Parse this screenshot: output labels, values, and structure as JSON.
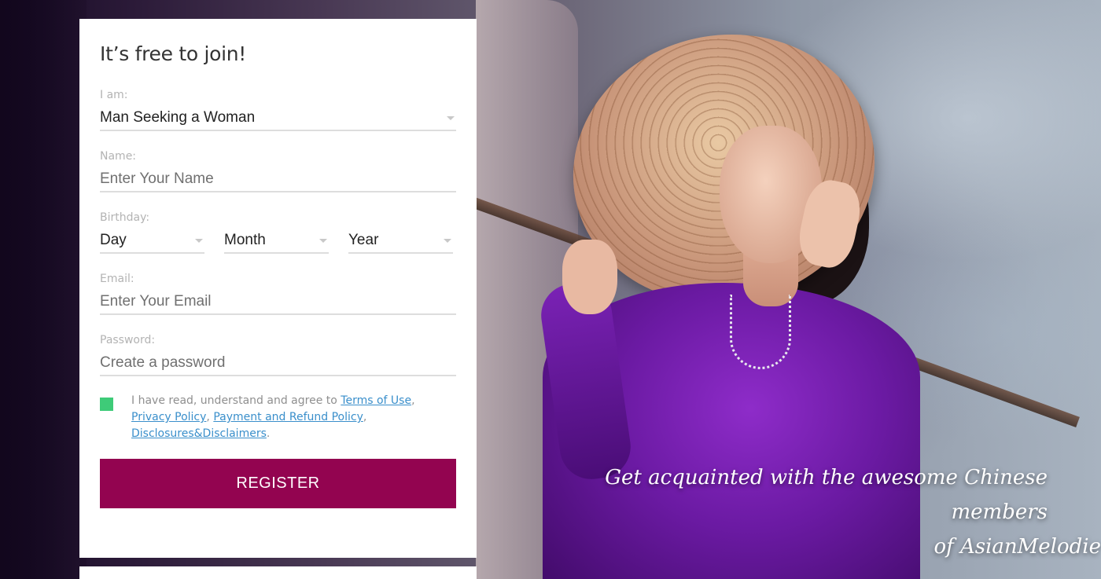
{
  "form": {
    "title": "It’s free to join!",
    "iam_label": "I am:",
    "iam_value": "Man Seeking a Woman",
    "name_label": "Name:",
    "name_placeholder": "Enter Your Name",
    "birthday_label": "Birthday:",
    "day_value": "Day",
    "month_value": "Month",
    "year_value": "Year",
    "email_label": "Email:",
    "email_placeholder": "Enter Your Email",
    "password_label": "Password:",
    "password_placeholder": "Create a password",
    "terms_prefix": "I have read, understand and agree to ",
    "terms_link": "Terms of Use",
    "privacy_link": "Privacy Policy",
    "refund_link": "Payment and Refund Policy",
    "disclosures_link": "Disclosures&Disclaimers",
    "register_label": "REGISTER",
    "checkbox_color": "#3ecb78",
    "button_color": "#930450",
    "link_color": "#3a8fcb"
  },
  "hero": {
    "tagline_line1": "Get acquainted with the awesome Chinese members",
    "tagline_line2": "of AsianMelodie"
  }
}
